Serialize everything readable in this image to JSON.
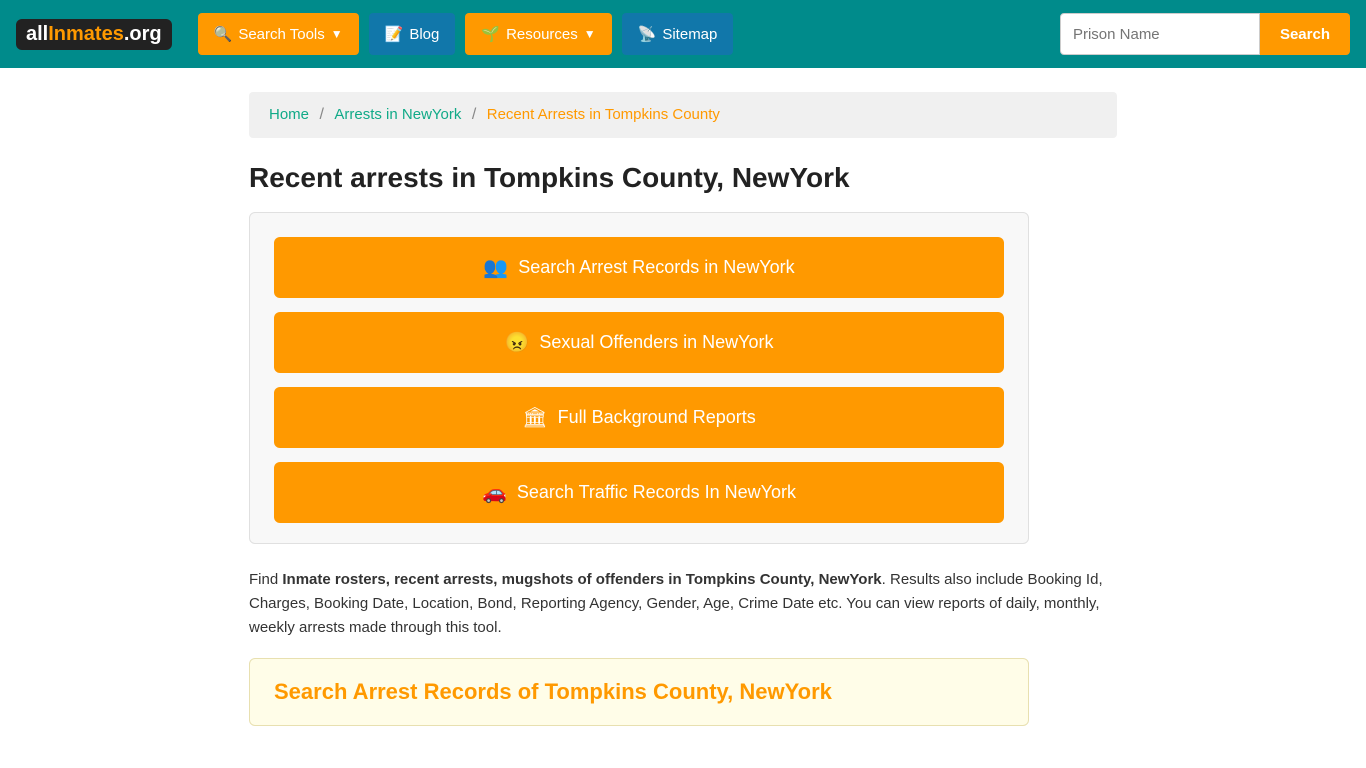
{
  "header": {
    "logo": {
      "all": "all",
      "inmates": "Inmates",
      "org": ".org"
    },
    "nav": [
      {
        "id": "search-tools",
        "label": "Search Tools",
        "icon": "🔍",
        "hasDropdown": true
      },
      {
        "id": "blog",
        "label": "Blog",
        "icon": "📝",
        "hasDropdown": false
      },
      {
        "id": "resources",
        "label": "Resources",
        "icon": "🌱",
        "hasDropdown": true
      },
      {
        "id": "sitemap",
        "label": "Sitemap",
        "icon": "📡",
        "hasDropdown": false
      }
    ],
    "search_placeholder": "Prison Name",
    "search_button_label": "Search"
  },
  "breadcrumb": {
    "home": "Home",
    "arrests": "Arrests in NewYork",
    "current": "Recent Arrests in Tompkins County"
  },
  "page": {
    "title": "Recent arrests in Tompkins County, NewYork",
    "action_buttons": [
      {
        "id": "arrest-records",
        "icon": "👥",
        "label": "Search Arrest Records in NewYork"
      },
      {
        "id": "sexual-offenders",
        "icon": "😠",
        "label": "Sexual Offenders in NewYork"
      },
      {
        "id": "background-reports",
        "icon": "🏛",
        "label": "Full Background Reports"
      },
      {
        "id": "traffic-records",
        "icon": "🚗",
        "label": "Search Traffic Records In NewYork"
      }
    ],
    "description": {
      "prefix": "Find ",
      "bold": "Inmate rosters, recent arrests, mugshots of offenders in Tompkins County, NewYork",
      "suffix": ". Results also include Booking Id, Charges, Booking Date, Location, Bond, Reporting Agency, Gender, Age, Crime Date etc. You can view reports of daily, monthly, weekly arrests made through this tool."
    },
    "search_section_title": "Search Arrest Records of Tompkins County, NewYork"
  }
}
